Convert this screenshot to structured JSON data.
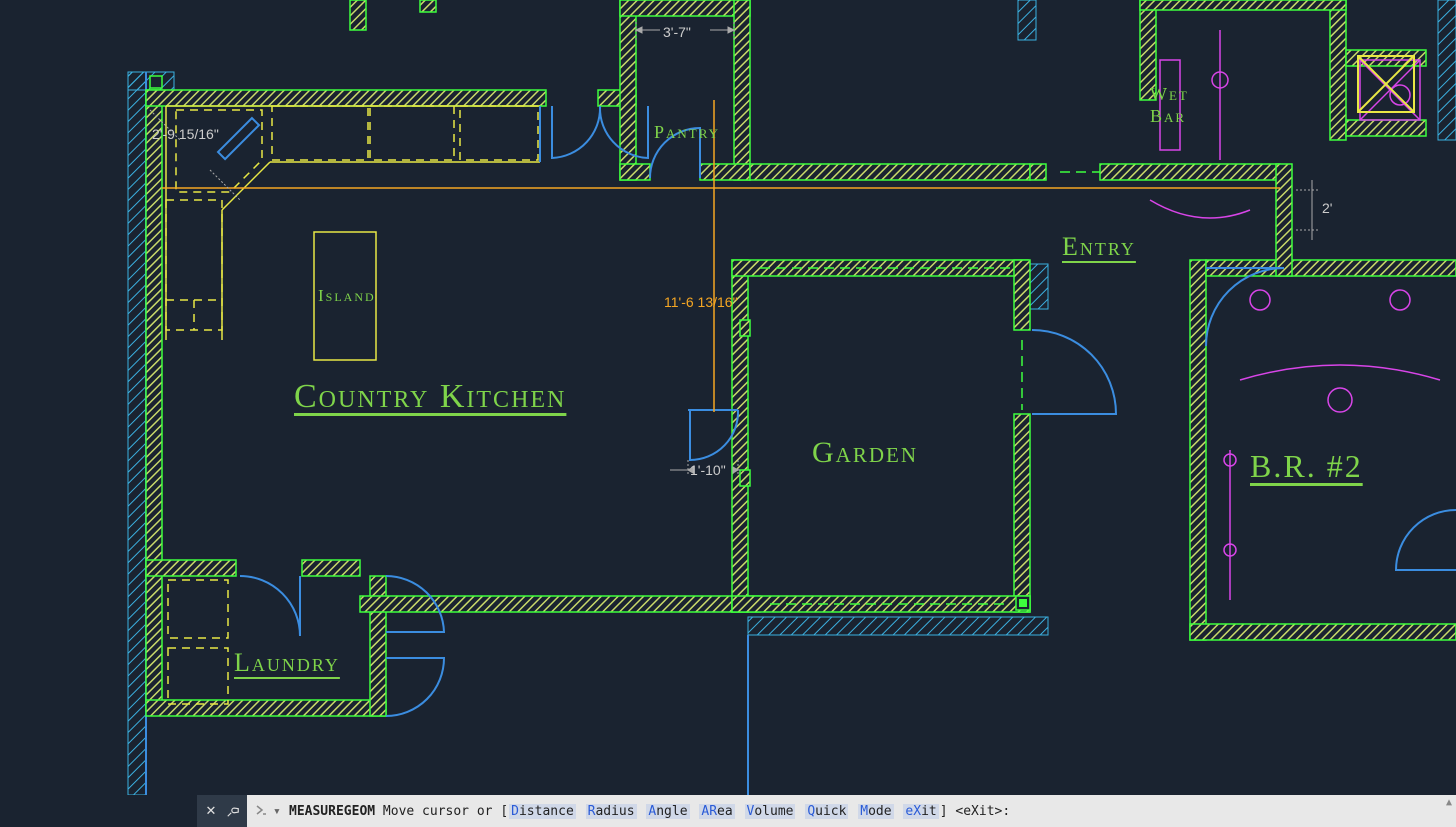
{
  "rooms": {
    "country_kitchen": "Country Kitchen",
    "island": "Island",
    "pantry": "Pantry",
    "entry": "Entry",
    "garden": "Garden",
    "br2": "B.R. #2",
    "wet_bar_1": "Wet",
    "wet_bar_2": "Bar",
    "laundry": "Laundry"
  },
  "dimensions": {
    "d1": "3'-7\"",
    "d2": "2'-9 15/16\"",
    "d3": "11'-6 13/16\"",
    "d4": "1'-10\"",
    "d5": "2'"
  },
  "commandbar": {
    "command": "MEASUREGEOM",
    "prompt_prefix": " Move cursor or [",
    "options": [
      {
        "hot": "D",
        "rest": "istance"
      },
      {
        "hot": "R",
        "rest": "adius"
      },
      {
        "hot": "A",
        "rest": "ngle"
      },
      {
        "hot": "AR",
        "rest": "ea"
      },
      {
        "hot": "V",
        "rest": "olume"
      },
      {
        "hot": "Q",
        "rest": "uick"
      },
      {
        "hot": "M",
        "rest": "ode"
      },
      {
        "hot": "eX",
        "rest": "it"
      }
    ],
    "prompt_suffix": "] <eXit>:"
  },
  "colors": {
    "bg": "#1a2330",
    "wall_fill": "#c9d96a",
    "wall_outline": "#3dff3d",
    "blue_line": "#3b8de0",
    "cyan_hatch": "#3bb0e0",
    "dim_gray": "#aaaaaa",
    "orange": "#f5a623",
    "magenta": "#d845e8",
    "yellow": "#e8e845",
    "room_text": "#7fd44a"
  }
}
